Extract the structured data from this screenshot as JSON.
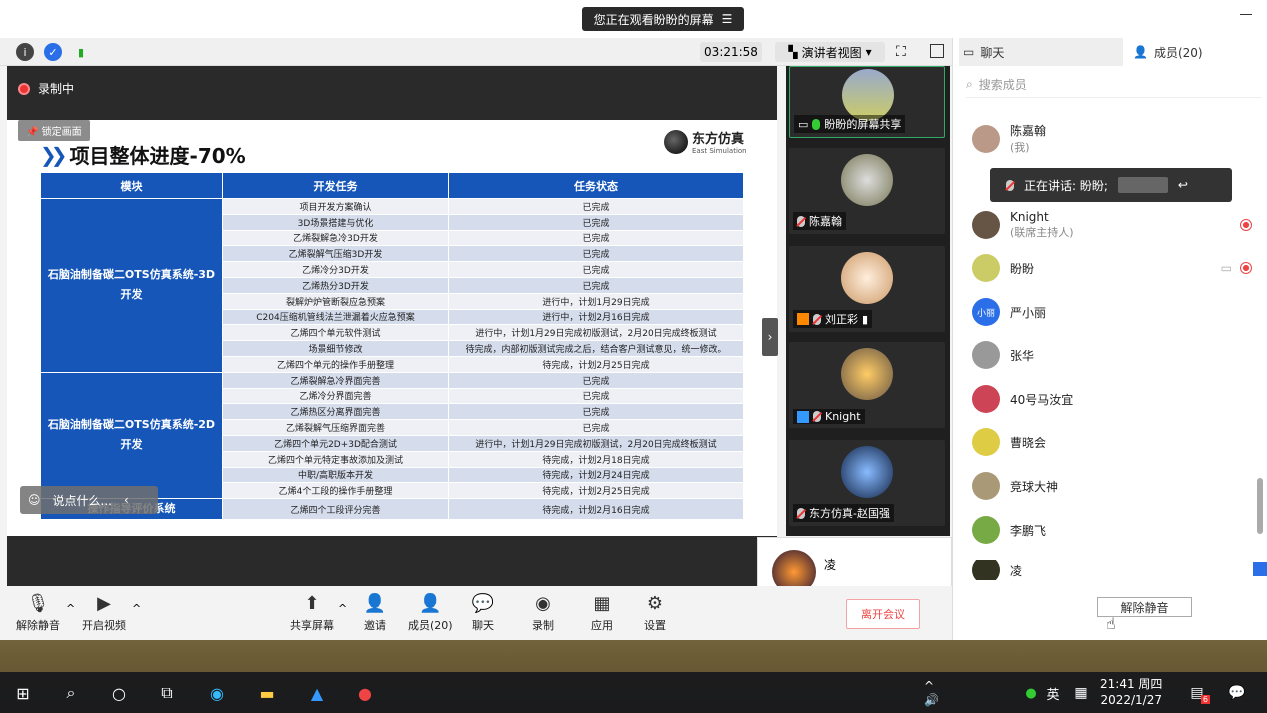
{
  "banner": {
    "text": "您正在观看盼盼的屏幕"
  },
  "toolbar": {
    "timer": "03:21:58",
    "view_label": "演讲者视图"
  },
  "share": {
    "recording_label": "录制中",
    "lock_label": "锁定画面",
    "chat_placeholder": "说点什么..."
  },
  "slide": {
    "title": "项目整体进度-70%",
    "logo_cn": "东方仿真",
    "logo_en": "East Simulation",
    "headers": [
      "模块",
      "开发任务",
      "任务状态"
    ],
    "group1": "石脑油制备碳二OTS仿真系统-3D开发",
    "group1_rows": [
      [
        "项目开发方案确认",
        "已完成"
      ],
      [
        "3D场景搭建与优化",
        "已完成"
      ],
      [
        "乙烯裂解急冷3D开发",
        "已完成"
      ],
      [
        "乙烯裂解气压缩3D开发",
        "已完成"
      ],
      [
        "乙烯冷分3D开发",
        "已完成"
      ],
      [
        "乙烯热分3D开发",
        "已完成"
      ],
      [
        "裂解炉炉管断裂应急预案",
        "进行中，计划1月29日完成"
      ],
      [
        "C204压缩机管线法兰泄漏着火应急预案",
        "进行中，计划2月16日完成"
      ],
      [
        "乙烯四个单元软件测试",
        "进行中，计划1月29日完成初版测试，2月20日完成终板测试"
      ],
      [
        "场景细节修改",
        "待完成，内部初版测试完成之后，结合客户测试意见，统一修改。"
      ],
      [
        "乙烯四个单元的操作手册整理",
        "待完成，计划2月25日完成"
      ]
    ],
    "group2": "石脑油制备碳二OTS仿真系统-2D开发",
    "group2_rows": [
      [
        "乙烯裂解急冷界面完善",
        "已完成"
      ],
      [
        "乙烯冷分界面完善",
        "已完成"
      ],
      [
        "乙烯热区分离界面完善",
        "已完成"
      ],
      [
        "乙烯裂解气压缩界面完善",
        "已完成"
      ],
      [
        "乙烯四个单元2D+3D配合测试",
        "进行中，计划1月29日完成初版测试，2月20日完成终板测试"
      ],
      [
        "乙烯四个单元特定事故添加及测试",
        "待完成，计划2月18日完成"
      ],
      [
        "中职/高职版本开发",
        "待完成，计划2月24日完成"
      ],
      [
        "乙烯4个工段的操作手册整理",
        "待完成，计划2月25日完成"
      ]
    ],
    "group3": "操作指导评价系统",
    "group3_rows": [
      [
        "乙烯四个工段评分完善",
        "待完成，计划2月16日完成"
      ]
    ]
  },
  "thumbs": [
    {
      "name": "盼盼的屏幕共享"
    },
    {
      "name": "陈嘉翰"
    },
    {
      "name": "刘正彩"
    },
    {
      "name": "Knight"
    },
    {
      "name": "东方仿真-赵国强"
    }
  ],
  "speaker_card": {
    "name": "凌"
  },
  "bottom": {
    "unmute": "解除静音",
    "video": "开启视频",
    "share": "共享屏幕",
    "invite": "邀请",
    "members": "成员(20)",
    "chat": "聊天",
    "record": "录制",
    "apps": "应用",
    "settings": "设置",
    "leave": "离开会议"
  },
  "panel": {
    "tab_chat": "聊天",
    "tab_members": "成员(20)",
    "search_placeholder": "搜索成员",
    "speaking": "正在讲话: 盼盼;",
    "members": [
      {
        "name": "陈嘉翰",
        "sub": "(我)"
      },
      {
        "name": "Knight",
        "sub": "(联席主持人)"
      },
      {
        "name": "盼盼",
        "sub": ""
      },
      {
        "name": "严小丽",
        "sub": ""
      },
      {
        "name": "张华",
        "sub": ""
      },
      {
        "name": "40号马汝宜",
        "sub": ""
      },
      {
        "name": "曹晓会",
        "sub": ""
      },
      {
        "name": "竞球大神",
        "sub": ""
      },
      {
        "name": "李鹏飞",
        "sub": ""
      },
      {
        "name": "凌",
        "sub": ""
      }
    ],
    "xiaoli_avatar": "小丽",
    "unmute_all": "解除静音"
  },
  "taskbar": {
    "time": "21:41 周四",
    "date": "2022/1/27",
    "ime": "英",
    "badge": "6"
  }
}
